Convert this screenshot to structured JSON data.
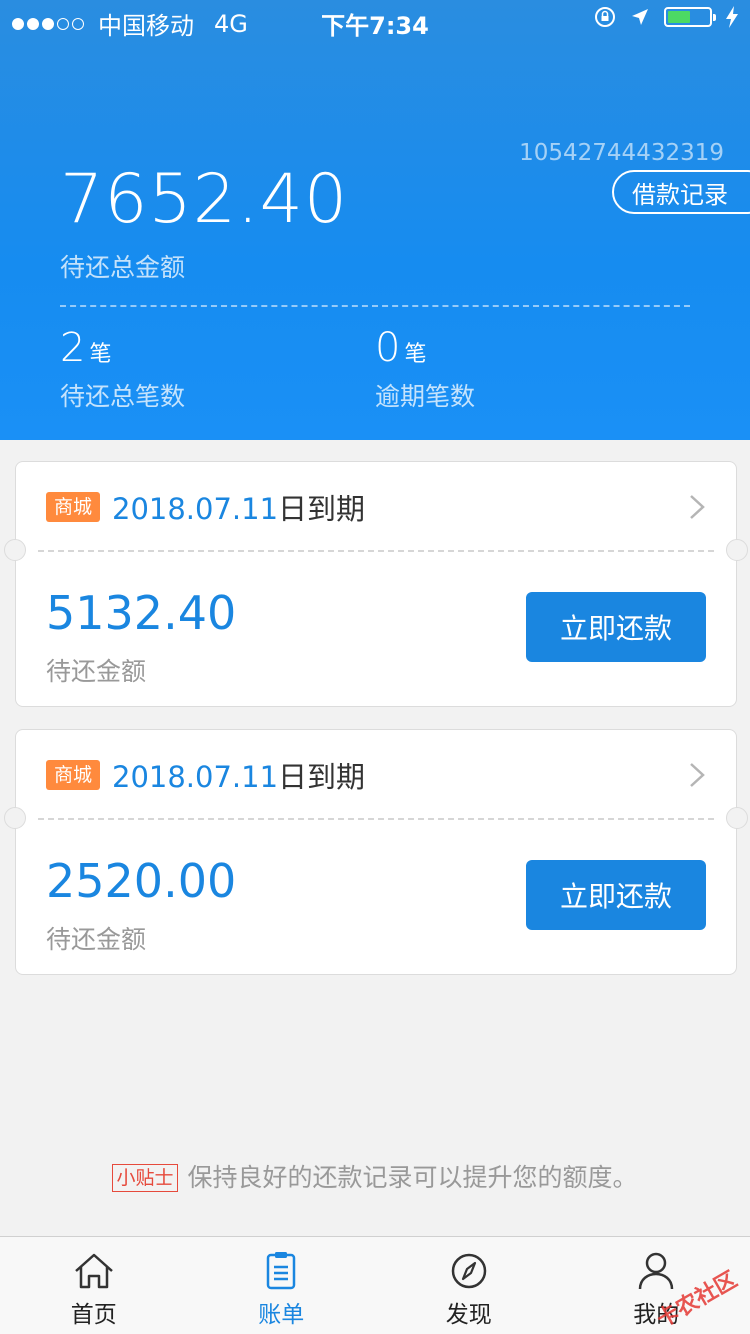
{
  "status_bar": {
    "carrier": "中国移动",
    "network": "4G",
    "time": "下午7:34"
  },
  "summary": {
    "account_no": "10542744432319",
    "record_button": "借款记录",
    "total_amount": "7652.40",
    "total_label": "待还总金额",
    "count_pending": "2",
    "count_pending_unit": "笔",
    "count_pending_label": "待还总笔数",
    "count_overdue": "0",
    "count_overdue_unit": "笔",
    "count_overdue_label": "逾期笔数"
  },
  "bills": [
    {
      "tag": "商城",
      "date": "2018.07.11",
      "suffix": "日到期",
      "amount": "5132.40",
      "amount_label": "待还金额",
      "pay_button": "立即还款"
    },
    {
      "tag": "商城",
      "date": "2018.07.11",
      "suffix": "日到期",
      "amount": "2520.00",
      "amount_label": "待还金额",
      "pay_button": "立即还款"
    }
  ],
  "tip": {
    "badge": "小贴士",
    "text": "保持良好的还款记录可以提升您的额度。"
  },
  "tabs": [
    {
      "label": "首页",
      "icon": "home-icon"
    },
    {
      "label": "账单",
      "icon": "bill-icon"
    },
    {
      "label": "发现",
      "icon": "compass-icon"
    },
    {
      "label": "我的",
      "icon": "user-icon"
    }
  ],
  "watermark": "卡农社区",
  "colors": {
    "primary": "#1a86e0",
    "tag": "#ff8a3d",
    "tip": "#e64a3c"
  }
}
